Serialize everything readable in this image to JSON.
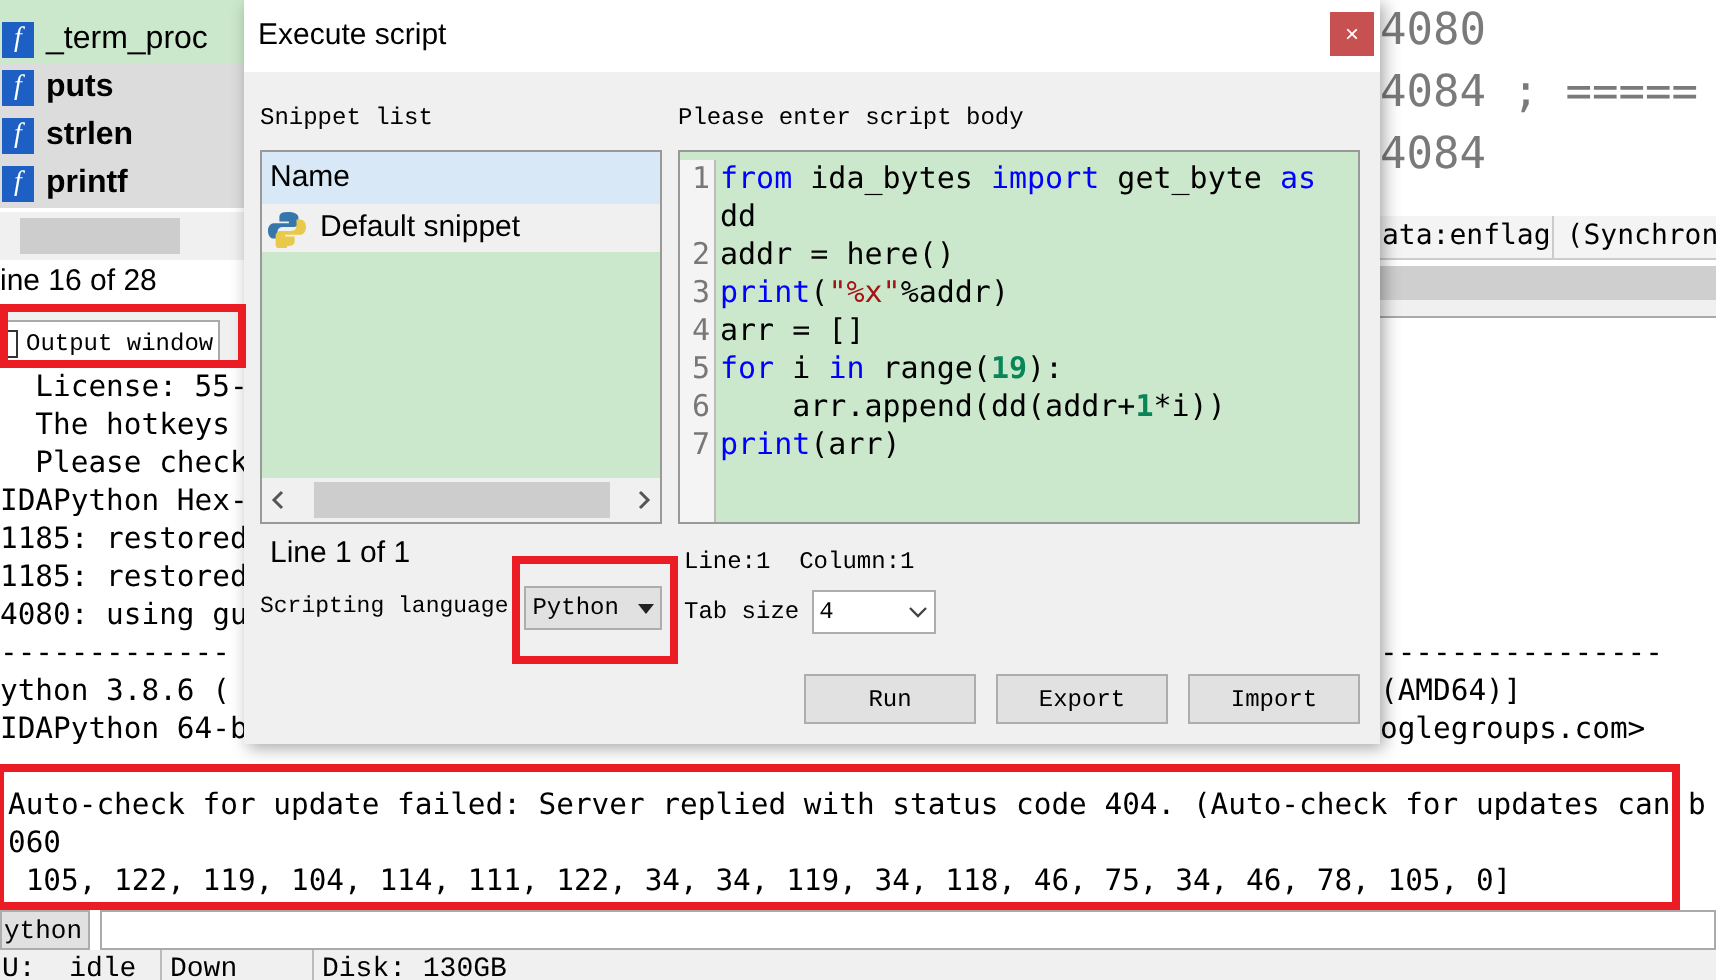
{
  "functions": [
    {
      "icon": "f",
      "name": "_term_proc",
      "selected": true
    },
    {
      "icon": "f",
      "name": "puts",
      "selected": false
    },
    {
      "icon": "f",
      "name": "strlen",
      "selected": false
    },
    {
      "icon": "f",
      "name": "printf",
      "selected": false
    }
  ],
  "functions_status": "ine 16 of 28",
  "disassembly": {
    "lines": [
      "4080",
      "4084 ; =====",
      "4084"
    ],
    "status": [
      "ata:enflag",
      "(Synchron"
    ]
  },
  "output_window": {
    "title": "Output window",
    "lines": [
      {
        "kind": "split",
        "left": "  License: 55-"
      },
      {
        "kind": "split",
        "left": "  The hotkeys"
      },
      {
        "kind": "split",
        "left": "  Please check"
      },
      {
        "kind": "split",
        "left": "IDAPython Hex-"
      },
      {
        "kind": "split",
        "left": "1185: restored"
      },
      {
        "kind": "split",
        "left": "1185: restored"
      },
      {
        "kind": "split",
        "left": "4080: using gu"
      },
      {
        "kind": "split",
        "left": "-------------",
        "right": "----------------"
      },
      {
        "kind": "split",
        "left": "ython 3.8.6 (",
        "right": "(AMD64)]"
      },
      {
        "kind": "split",
        "left": "IDAPython 64-b",
        "right": "oglegroups.com>"
      },
      {
        "kind": "blank"
      },
      {
        "kind": "full",
        "text": "Auto-check for update failed: Server replied with status code 404. (Auto-check for updates can b"
      },
      {
        "kind": "full",
        "text": "060"
      },
      {
        "kind": "full",
        "text": " 105, 122, 119, 104, 114, 111, 122, 34, 34, 119, 34, 118, 46, 75, 34, 46, 78, 105, 0]"
      }
    ],
    "language_button": "ython"
  },
  "status_bar": [
    "U:  idle",
    "Down",
    "Disk: 130GB"
  ],
  "dialog": {
    "title": "Execute script",
    "close": "×",
    "snippet_label": "Snippet list",
    "column": "Name",
    "snippets": [
      {
        "name": "Default snippet",
        "selected": false
      }
    ],
    "snippet_status": "Line 1 of 1",
    "language_label": "Scripting language",
    "language": "Python",
    "body_label": "Please enter script body",
    "code_lines": [
      {
        "number": "1",
        "tokens": [
          {
            "kind": "keyword",
            "text": "from"
          },
          {
            "kind": "plain",
            "text": " ida_bytes "
          },
          {
            "kind": "keyword",
            "text": "import"
          },
          {
            "kind": "plain",
            "text": " get_byte "
          },
          {
            "kind": "keyword",
            "text": "as"
          },
          {
            "kind": "plain",
            "text": " dd"
          }
        ]
      },
      {
        "number": "2",
        "tokens": [
          {
            "kind": "plain",
            "text": "addr = here()"
          }
        ]
      },
      {
        "number": "3",
        "tokens": [
          {
            "kind": "keyword",
            "text": "print"
          },
          {
            "kind": "plain",
            "text": "("
          },
          {
            "kind": "string",
            "text": "\"%x\""
          },
          {
            "kind": "plain",
            "text": "%addr)"
          }
        ]
      },
      {
        "number": "4",
        "tokens": [
          {
            "kind": "plain",
            "text": "arr = []"
          }
        ]
      },
      {
        "number": "5",
        "tokens": [
          {
            "kind": "keyword",
            "text": "for"
          },
          {
            "kind": "plain",
            "text": " i "
          },
          {
            "kind": "keyword",
            "text": "in"
          },
          {
            "kind": "plain",
            "text": " range("
          },
          {
            "kind": "number",
            "text": "19"
          },
          {
            "kind": "plain",
            "text": "):"
          }
        ]
      },
      {
        "number": "6",
        "tokens": [
          {
            "kind": "plain",
            "text": "    arr.append(dd(addr+"
          },
          {
            "kind": "number",
            "text": "1"
          },
          {
            "kind": "plain",
            "text": "*i))"
          }
        ]
      },
      {
        "number": "7",
        "tokens": [
          {
            "kind": "keyword",
            "text": "print"
          },
          {
            "kind": "plain",
            "text": "(arr)"
          }
        ]
      }
    ],
    "cursor": "Line:1  Column:1",
    "tab_size_label": "Tab size",
    "tab_size": "4",
    "buttons": [
      "Run",
      "Export",
      "Import"
    ]
  }
}
